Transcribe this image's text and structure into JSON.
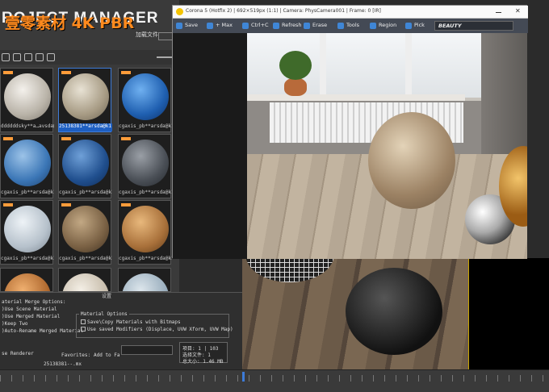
{
  "project_manager": {
    "title": "ROJECT MANAGER",
    "subtitle": "加载文件",
    "watermark": "壹零素材 4K PBR",
    "thumbnails": [
      {
        "label": "ddddddsky**a…avsda@k1]",
        "selected": false
      },
      {
        "label": "25138381**arsda@k1]",
        "selected": true
      },
      {
        "label": "cgaxis_pb**arsda@k1]",
        "selected": false
      },
      {
        "label": "cgaxis_pb**arsda@k1]",
        "selected": false
      },
      {
        "label": "cgaxis_pb**arsda@k1]",
        "selected": false
      },
      {
        "label": "cgaxis_pb**arsda@k1]",
        "selected": false
      },
      {
        "label": "cgaxis_pb**arsda@k1]",
        "selected": false
      },
      {
        "label": "cgaxis_pb**arsda@k1]",
        "selected": false
      },
      {
        "label": "cgaxis_pb**arsda@k1]",
        "selected": false
      }
    ],
    "options_tag": "设置",
    "merge_options_title": "aterial Merge Options:",
    "merge_options": [
      "Use Scene Material",
      "Use Merged Material",
      "Keep Two",
      "Auto-Rename Merged Material"
    ],
    "material_options_title": "Material Options",
    "material_options": [
      "Save\\Copy Materials with Bitmaps",
      "Use saved Modifiers (Displace, UVW Xform, UVW Map)"
    ],
    "renderer_label": "se Renderer",
    "favorites_label": "Favorites:",
    "favorites_value": "Add to Fa",
    "file_name": "25138381--.mx",
    "status_lines": [
      "项目: 1 | 103",
      "选择文件: 1",
      "总大小: 1.46 MB"
    ]
  },
  "render_window": {
    "title": "Corona 5 (Hotfix 2) | 692×519px (1:1) | Camera: PhysCamera001 | Frame: 0 [IR]",
    "toolbar": [
      {
        "label": "Save",
        "icon": "save-icon"
      },
      {
        "label": "+ Max",
        "icon": "max-icon"
      },
      {
        "label": "Ctrl+C",
        "icon": "copy-icon"
      },
      {
        "label": "Refresh",
        "icon": "refresh-icon"
      },
      {
        "label": "Erase",
        "icon": "erase-icon"
      },
      {
        "label": "Tools",
        "icon": "tools-icon"
      },
      {
        "label": "Region",
        "icon": "region-icon"
      },
      {
        "label": "Pick",
        "icon": "pick-icon"
      }
    ],
    "pass": "BEAUTY"
  },
  "colors": {
    "accent": "#3d7bd8",
    "watermark": "#ff8a1e",
    "toolbar": "#444a55"
  }
}
